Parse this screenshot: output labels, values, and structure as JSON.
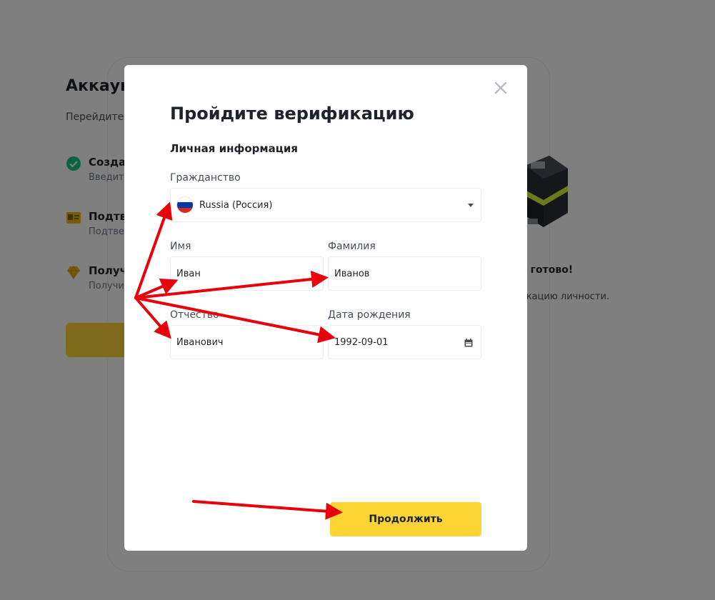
{
  "background": {
    "title": "Аккаун",
    "subtitle": "Перейдите",
    "steps": [
      {
        "title": "Создат",
        "desc": "Введите"
      },
      {
        "title": "Подтве",
        "desc": "Подтвер"
      },
      {
        "title": "Получ",
        "desc": "Получит"
      }
    ],
    "ready_text": "се готово!",
    "identity_text": "рикацию личности."
  },
  "modal": {
    "title": "Пройдите верификацию",
    "section": "Личная информация",
    "citizenship": {
      "label": "Гражданство",
      "value": "Russia (Россия)",
      "flag_colors": [
        "#ffffff",
        "#0039a6",
        "#d52b1e"
      ]
    },
    "first_name": {
      "label": "Имя",
      "value": "Иван"
    },
    "last_name": {
      "label": "Фамилия",
      "value": "Иванов"
    },
    "patronymic": {
      "label": "Отчество",
      "value": "Иванович"
    },
    "birth_date": {
      "label": "Дата рождения",
      "value": "1992-09-01"
    },
    "continue_label": "Продолжить",
    "close_icon": "close-icon"
  },
  "colors": {
    "accent": "#fcd535",
    "overlay": "rgba(0,0,0,0.5)",
    "annotation_arrow": "#e8000b"
  }
}
